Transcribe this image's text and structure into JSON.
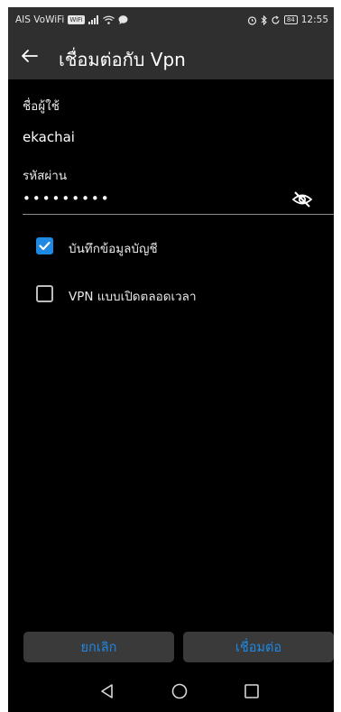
{
  "status_bar": {
    "carrier": "AIS VoWiFi",
    "wifi_badge": "WiFi",
    "signal_icon": "signal-icon",
    "left_icons": [
      "signal-icon",
      "wifi-icon",
      "messenger-icon"
    ],
    "right_icons": [
      "alarm-icon",
      "bluetooth-icon",
      "sync-icon",
      "battery-icon"
    ],
    "battery": "84",
    "time": "12:55"
  },
  "app_bar": {
    "title": "เชื่อมต่อกับ Vpn",
    "back_icon": "arrow-left-icon"
  },
  "form": {
    "username_label": "ชื่อผู้ใช้",
    "username_value": "ekachai",
    "password_label": "รหัสผ่าน",
    "password_masked": "•••••••••",
    "password_toggle_icon": "eye-off-icon"
  },
  "options": [
    {
      "label": "บันทึกข้อมูลบัญชี",
      "checked": true
    },
    {
      "label": "VPN แบบเปิดตลอดเวลา",
      "checked": false
    }
  ],
  "buttons": {
    "cancel": "ยกเลิก",
    "connect": "เชื่อมต่อ"
  },
  "nav_bar": {
    "icons": [
      "back-triangle-icon",
      "home-circle-icon",
      "recents-square-icon"
    ]
  },
  "colors": {
    "accent": "#1e88e5",
    "background": "#000000",
    "bar": "#2f2f2f",
    "button_bg": "#3a3a3a"
  }
}
